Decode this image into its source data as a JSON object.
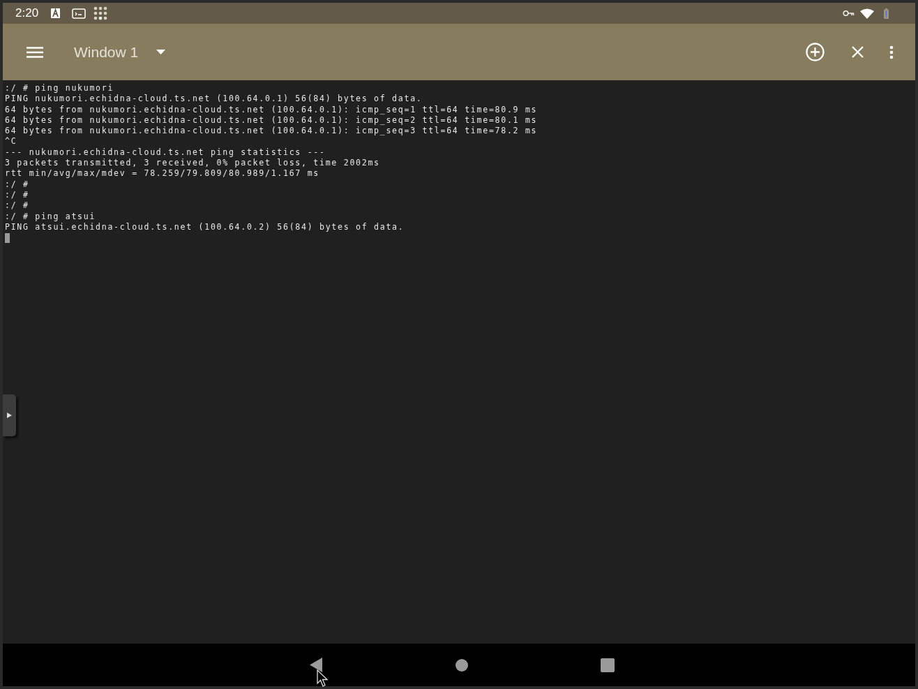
{
  "status_bar": {
    "time": "2:20"
  },
  "toolbar": {
    "title": "Window 1"
  },
  "terminal": {
    "lines": [
      ":/ # ping nukumori",
      "PING nukumori.echidna-cloud.ts.net (100.64.0.1) 56(84) bytes of data.",
      "64 bytes from nukumori.echidna-cloud.ts.net (100.64.0.1): icmp_seq=1 ttl=64 time=80.9 ms",
      "64 bytes from nukumori.echidna-cloud.ts.net (100.64.0.1): icmp_seq=2 ttl=64 time=80.1 ms",
      "64 bytes from nukumori.echidna-cloud.ts.net (100.64.0.1): icmp_seq=3 ttl=64 time=78.2 ms",
      "^C",
      "--- nukumori.echidna-cloud.ts.net ping statistics ---",
      "3 packets transmitted, 3 received, 0% packet loss, time 2002ms",
      "rtt min/avg/max/mdev = 78.259/79.809/80.989/1.167 ms",
      ":/ #",
      ":/ #",
      ":/ #",
      ":/ # ping atsui",
      "PING atsui.echidna-cloud.ts.net (100.64.0.2) 56(84) bytes of data."
    ]
  }
}
